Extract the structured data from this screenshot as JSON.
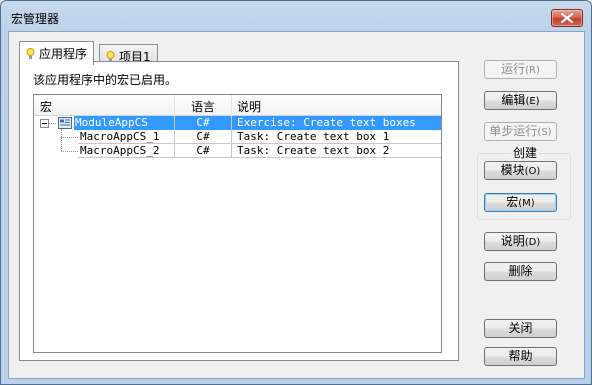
{
  "window": {
    "title": "宏管理器"
  },
  "tabs": [
    {
      "label": "应用程序",
      "active": true,
      "icon": "lightbulb-icon"
    },
    {
      "label": "项目1",
      "active": false,
      "icon": "lightbulb-icon"
    }
  ],
  "panel": {
    "message": "该应用程序中的宏已启用。"
  },
  "list": {
    "columns": [
      "宏",
      "语言",
      "说明"
    ],
    "rows": [
      {
        "name": "ModuleAppCS",
        "language": "C#",
        "description": "Exercise: Create text boxes",
        "selected": true,
        "icon": "module-icon"
      },
      {
        "name": "MacroAppCS_1",
        "language": "C#",
        "description": "Task: Create text box 1",
        "selected": false
      },
      {
        "name": "MacroAppCS_2",
        "language": "C#",
        "description": "Task: Create text box 2",
        "selected": false
      }
    ]
  },
  "buttons": {
    "run": "运行",
    "run_key": "(R)",
    "edit": "编辑",
    "edit_key": "(E)",
    "step": "单步运行",
    "step_key": "(S)",
    "create_group": "创建",
    "module": "模块",
    "module_key": "(O)",
    "macro": "宏",
    "macro_key": "(M)",
    "describe": "说明",
    "describe_key": "(D)",
    "delete": "删除",
    "close": "关闭",
    "help": "帮助"
  },
  "colors": {
    "selection": "#3399ff",
    "title_bar": "#bcd3eb",
    "close_button": "#c8503b"
  }
}
